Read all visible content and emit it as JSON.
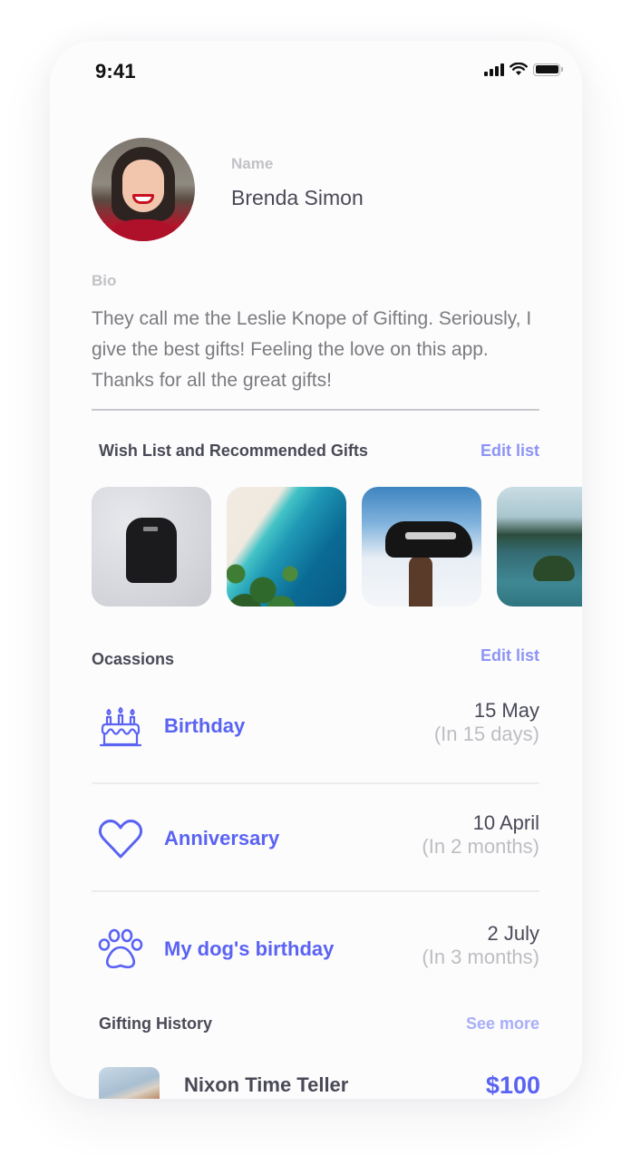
{
  "status_bar": {
    "time": "9:41",
    "icons": [
      "cellular-signal-icon",
      "wifi-icon",
      "battery-icon"
    ]
  },
  "profile": {
    "avatar_alt": "Profile photo of smiling woman",
    "name_label": "Name",
    "name_value": "Brenda Simon",
    "bio_label": "Bio",
    "bio_value": "They call me the Leslie Knope of Gifting. Seriously, I give the best gifts! Feeling the love on this app. Thanks for all the great gifts!"
  },
  "wishlist": {
    "title": "Wish List and Recommended Gifts",
    "action": "Edit list",
    "items": [
      {
        "name": "Backpack on snow"
      },
      {
        "name": "Aerial beach"
      },
      {
        "name": "Sneaker held up to the sky"
      },
      {
        "name": "Bay with islands"
      }
    ]
  },
  "occasions": {
    "title": "Ocassions",
    "action": "Edit list",
    "items": [
      {
        "icon": "birthday-cake-icon",
        "label": "Birthday",
        "date": "15 May",
        "relative": "(In 15 days)"
      },
      {
        "icon": "heart-icon",
        "label": "Anniversary",
        "date": "10 April",
        "relative": "(In 2 months)"
      },
      {
        "icon": "paw-icon",
        "label": "My dog's birthday",
        "date": "2 July",
        "relative": "(In 3 months)"
      }
    ]
  },
  "gifting_history": {
    "title": "Gifting History",
    "action": "See more",
    "items": [
      {
        "name": "Nixon Time Teller",
        "price": "$100"
      }
    ]
  },
  "colors": {
    "accent": "#5a63f2",
    "accent_light": "#8d94f5",
    "text_dark": "#4a4a57",
    "text_muted": "#bdbdc2"
  }
}
